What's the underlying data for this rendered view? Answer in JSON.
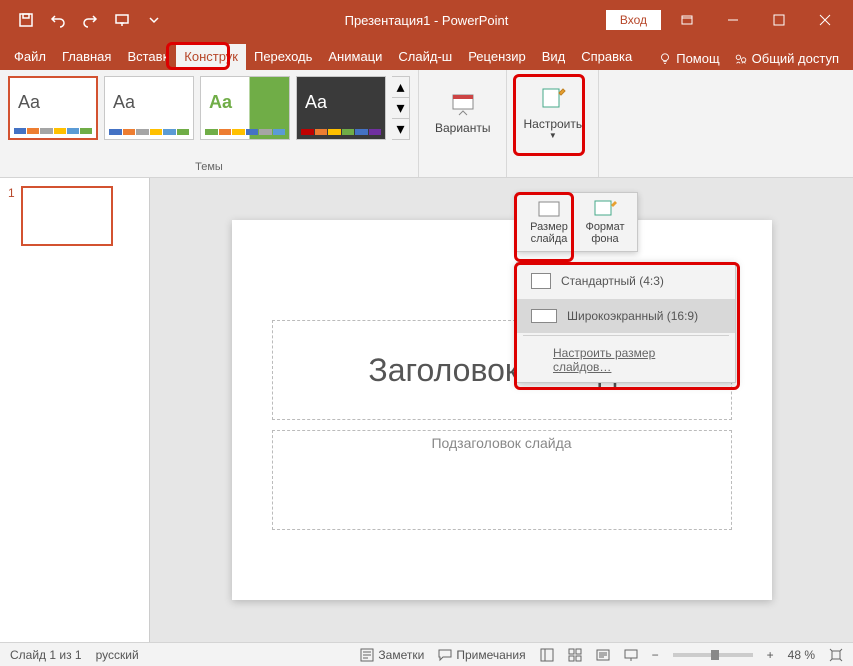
{
  "title": "Презентация1 - PowerPoint",
  "signin": "Вход",
  "tabs": {
    "file": "Файл",
    "home": "Главная",
    "insert": "Вставк",
    "design": "Конструк",
    "transitions": "Переходь",
    "animations": "Анимаци",
    "slideshow": "Слайд-ш",
    "review": "Рецензир",
    "view": "Вид",
    "help": "Справка",
    "tellme": "Помощ",
    "share": "Общий доступ"
  },
  "ribbon": {
    "themes_label": "Темы",
    "variants": "Варианты",
    "customize": "Настроить",
    "theme_colors": [
      [
        "#4472c4",
        "#ed7d31",
        "#a5a5a5",
        "#ffc000",
        "#5b9bd5",
        "#70ad47"
      ],
      [
        "#4472c4",
        "#ed7d31",
        "#a5a5a5",
        "#ffc000",
        "#5b9bd5",
        "#70ad47"
      ],
      [
        "#70ad47",
        "#ed7d31",
        "#ffc000",
        "#4472c4",
        "#a5a5a5",
        "#5b9bd5"
      ],
      [
        "#c00000",
        "#ed7d31",
        "#ffc000",
        "#70ad47",
        "#4472c4",
        "#7030a0"
      ]
    ]
  },
  "slide_size_panel": {
    "size_btn": "Размер слайда",
    "format_btn": "Формат фона",
    "standard": "Стандартный (4:3)",
    "widescreen": "Широкоэкранный (16:9)",
    "custom": "Настроить размер слайдов…"
  },
  "slide": {
    "title_ph": "Заголовок слайда",
    "subtitle_ph": "Подзаголовок слайда"
  },
  "thumbs": {
    "num1": "1"
  },
  "status": {
    "slide_of": "Слайд 1 из 1",
    "lang": "русский",
    "notes": "Заметки",
    "comments": "Примечания",
    "zoom": "48 %"
  }
}
